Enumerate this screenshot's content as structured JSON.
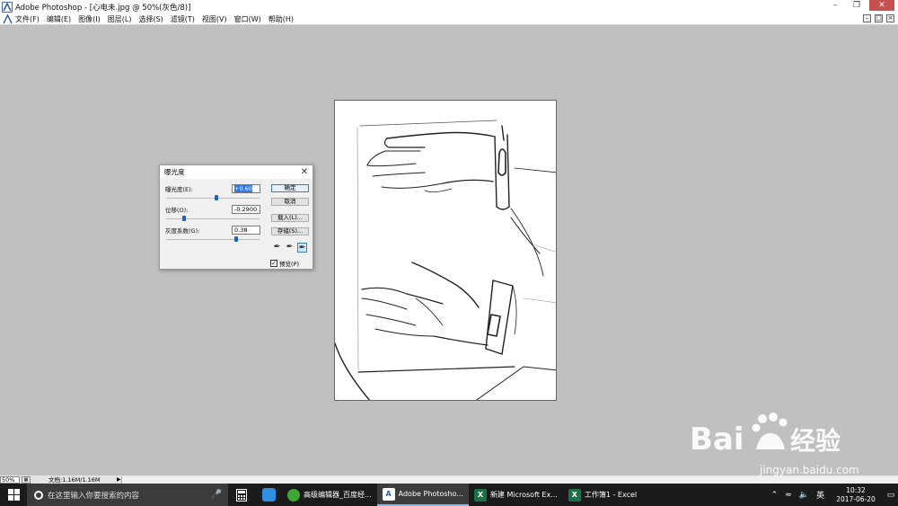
{
  "window": {
    "title": "Adobe Photoshop - [心电未.jpg @ 50%(灰色/8)]"
  },
  "menu": {
    "items": [
      "文件(F)",
      "编辑(E)",
      "图像(I)",
      "图层(L)",
      "选择(S)",
      "滤镜(T)",
      "视图(V)",
      "窗口(W)",
      "帮助(H)"
    ]
  },
  "dialog": {
    "title": "曝光度",
    "exposure": {
      "label": "曝光度(E):",
      "value": "+0.60",
      "slider_fraction": 0.56
    },
    "offset": {
      "label": "位移(O):",
      "value": "-0.2900",
      "slider_fraction": 0.2
    },
    "gamma": {
      "label": "灰度系数(G):",
      "value": "0.38",
      "slider_fraction": 0.78
    },
    "buttons": {
      "ok": "确定",
      "cancel": "取消",
      "load": "载入(L)...",
      "save": "存储(S)..."
    },
    "preview": {
      "label": "预览(P)",
      "checked": true
    }
  },
  "status": {
    "zoom": "50%",
    "doc_info": "文档:1.16M/1.16M"
  },
  "taskbar": {
    "search_placeholder": "在这里输入你要搜索的内容",
    "apps": [
      {
        "label": "高级编辑器_百度经...",
        "icon": "wechat-like-icon",
        "color": "#3fa535"
      },
      {
        "label": "Adobe Photosho...",
        "icon": "photoshop-icon",
        "color": "#ffffff",
        "active": true
      },
      {
        "label": "新建 Microsoft Ex...",
        "icon": "excel-icon",
        "color": "#1e7145"
      },
      {
        "label": "工作簿1 - Excel",
        "icon": "excel-icon",
        "color": "#1e7145"
      }
    ],
    "tray_lang": "英",
    "time": "10:32",
    "date": "2017-06-20"
  },
  "watermark": {
    "logo": "Bai  经验",
    "url": "jingyan.baidu.com"
  }
}
